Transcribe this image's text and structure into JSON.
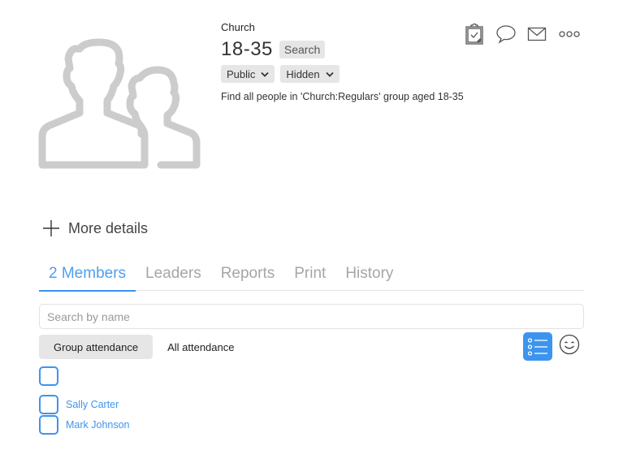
{
  "group": {
    "category": "Church",
    "title": "18-35",
    "title_badge": "Search",
    "visibility": "Public",
    "status": "Hidden",
    "description": "Find all people in 'Church:Regulars' group aged 18-35",
    "avatar_icon": "people-group-icon"
  },
  "actions": [
    {
      "name": "tasks",
      "icon": "clipboard-check-icon"
    },
    {
      "name": "message",
      "icon": "chat-bubble-icon"
    },
    {
      "name": "email",
      "icon": "envelope-icon"
    },
    {
      "name": "more",
      "icon": "ellipsis-icon"
    }
  ],
  "more_details": {
    "label": "More details",
    "icon": "plus-icon"
  },
  "tabs": [
    {
      "label": "2 Members",
      "active": true
    },
    {
      "label": "Leaders",
      "active": false
    },
    {
      "label": "Reports",
      "active": false
    },
    {
      "label": "Print",
      "active": false
    },
    {
      "label": "History",
      "active": false
    }
  ],
  "search": {
    "placeholder": "Search by name",
    "value": ""
  },
  "attendance": {
    "group_label": "Group attendance",
    "all_label": "All attendance",
    "selected": "Group attendance"
  },
  "view_toggle": {
    "list_icon": "list-view-icon",
    "face_icon": "smiley-face-icon",
    "selected": "list"
  },
  "members": [
    {
      "name": "Sally Carter",
      "checked": false
    },
    {
      "name": "Mark Johnson",
      "checked": false
    }
  ],
  "colors": {
    "accent": "#3d94ee",
    "chip_bg": "#e6e6e6",
    "avatar": "#cccccc"
  }
}
